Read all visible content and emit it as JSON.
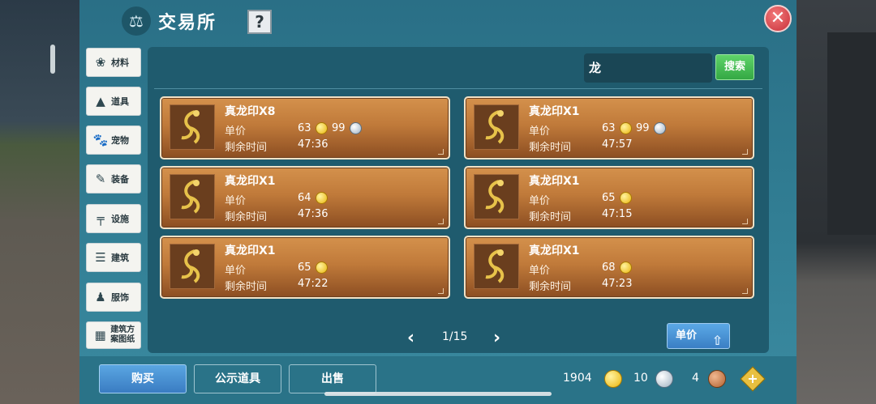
{
  "header": {
    "title": "交易所",
    "help_label": "?",
    "close_label": "✕"
  },
  "categories": [
    {
      "label": "材料",
      "icon": "materials-icon",
      "glyph": "❀"
    },
    {
      "label": "道具",
      "icon": "props-icon",
      "glyph": "▲"
    },
    {
      "label": "宠物",
      "icon": "paw-icon",
      "glyph": "🐾"
    },
    {
      "label": "装备",
      "icon": "equipment-icon",
      "glyph": "✎"
    },
    {
      "label": "设施",
      "icon": "facility-icon",
      "glyph": "╤"
    },
    {
      "label": "建筑",
      "icon": "building-icon",
      "glyph": "☰"
    },
    {
      "label": "服饰",
      "icon": "clothing-icon",
      "glyph": "♟"
    },
    {
      "label": "建筑方案图纸",
      "icon": "blueprint-icon",
      "glyph": "▦"
    }
  ],
  "search": {
    "value": "龙",
    "button_label": "搜索"
  },
  "listings": [
    {
      "name": "真龙印X8",
      "price_label": "单价",
      "gold": "63",
      "silver": "99",
      "time_label": "剩余时间",
      "time": "47:36"
    },
    {
      "name": "真龙印X1",
      "price_label": "单价",
      "gold": "63",
      "silver": "99",
      "time_label": "剩余时间",
      "time": "47:57"
    },
    {
      "name": "真龙印X1",
      "price_label": "单价",
      "gold": "64",
      "silver": "",
      "time_label": "剩余时间",
      "time": "47:36"
    },
    {
      "name": "真龙印X1",
      "price_label": "单价",
      "gold": "65",
      "silver": "",
      "time_label": "剩余时间",
      "time": "47:15"
    },
    {
      "name": "真龙印X1",
      "price_label": "单价",
      "gold": "65",
      "silver": "",
      "time_label": "剩余时间",
      "time": "47:22"
    },
    {
      "name": "真龙印X1",
      "price_label": "单价",
      "gold": "68",
      "silver": "",
      "time_label": "剩余时间",
      "time": "47:23"
    }
  ],
  "pagination": {
    "current": "1/15",
    "prev": "‹",
    "next": "›"
  },
  "sort": {
    "label": "单价"
  },
  "bottom_tabs": {
    "buy": "购买",
    "public": "公示道具",
    "sell": "出售"
  },
  "currency": {
    "gold": "1904",
    "silver": "10",
    "bronze": "4"
  },
  "colors": {
    "panel": "#2f7a90",
    "card": "#c07a3a",
    "accent_green": "#34a844",
    "accent_blue": "#3a7cc2"
  }
}
